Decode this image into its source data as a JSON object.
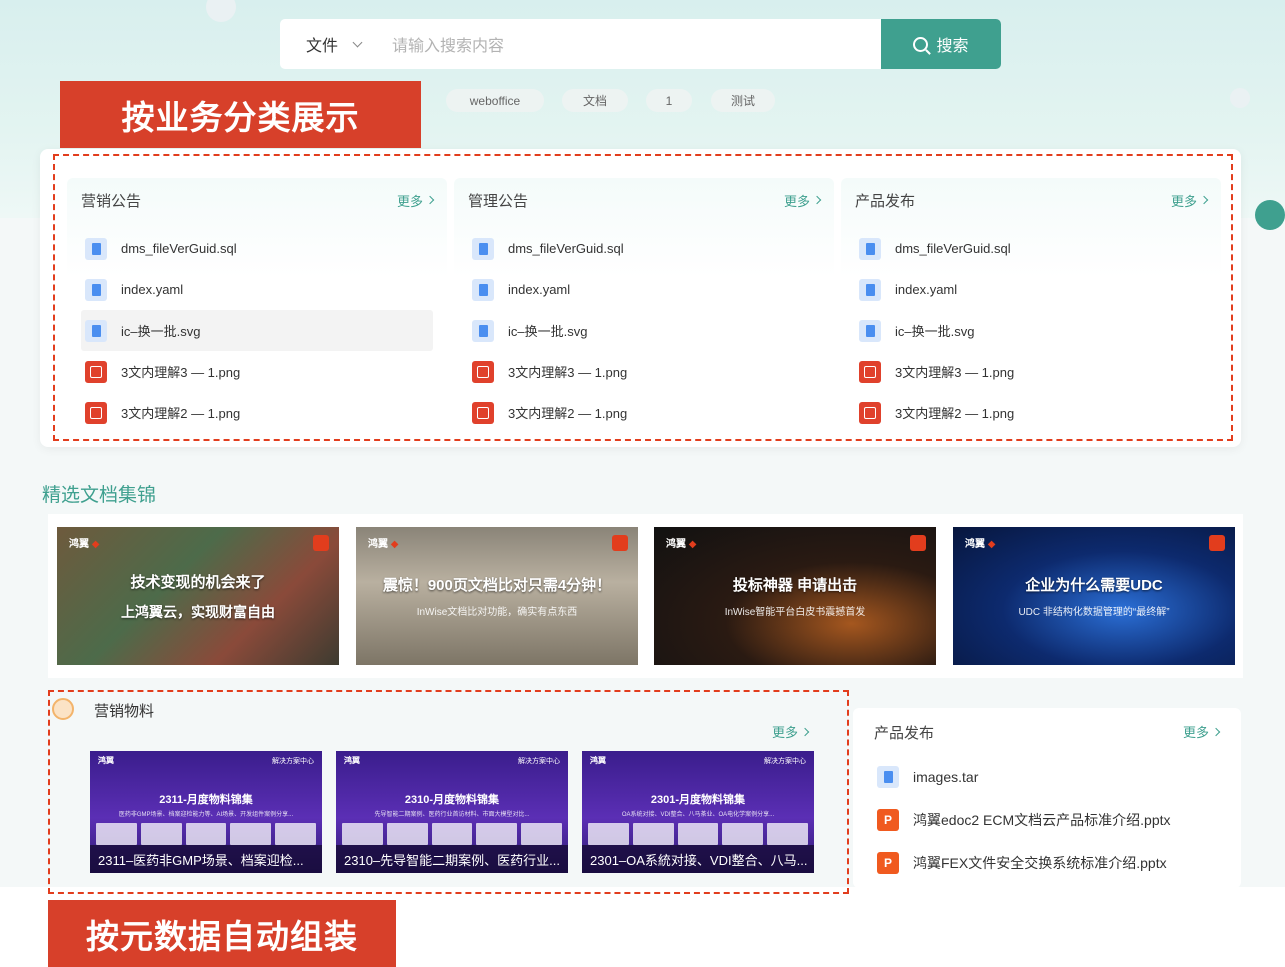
{
  "search": {
    "type_label": "文件",
    "placeholder": "请输入搜索内容",
    "button_label": "搜索",
    "tags": [
      "weboffice",
      "文档",
      "1",
      "测试"
    ]
  },
  "annotations": {
    "top_banner": "按业务分类展示",
    "bottom_banner": "按元数据自动组装"
  },
  "category_cards": [
    {
      "title": "营销公告",
      "more": "更多",
      "files": [
        {
          "name": "dms_fileVerGuid.sql",
          "icon": "doc-icon"
        },
        {
          "name": "index.yaml",
          "icon": "doc-icon"
        },
        {
          "name": "ic–换一批.svg",
          "icon": "doc-icon",
          "highlighted": true
        },
        {
          "name": "3文内理解3 — 1.png",
          "icon": "image-icon"
        },
        {
          "name": "3文内理解2 — 1.png",
          "icon": "image-icon"
        }
      ]
    },
    {
      "title": "管理公告",
      "more": "更多",
      "files": [
        {
          "name": "dms_fileVerGuid.sql",
          "icon": "doc-icon"
        },
        {
          "name": "index.yaml",
          "icon": "doc-icon"
        },
        {
          "name": "ic–换一批.svg",
          "icon": "doc-icon"
        },
        {
          "name": "3文内理解3 — 1.png",
          "icon": "image-icon"
        },
        {
          "name": "3文内理解2 — 1.png",
          "icon": "image-icon"
        }
      ]
    },
    {
      "title": "产品发布",
      "more": "更多",
      "files": [
        {
          "name": "dms_fileVerGuid.sql",
          "icon": "doc-icon"
        },
        {
          "name": "index.yaml",
          "icon": "doc-icon"
        },
        {
          "name": "ic–换一批.svg",
          "icon": "doc-icon"
        },
        {
          "name": "3文内理解3 — 1.png",
          "icon": "image-icon"
        },
        {
          "name": "3文内理解2 — 1.png",
          "icon": "image-icon"
        }
      ]
    }
  ],
  "featured": {
    "title": "精选文档集锦",
    "brand": "鸿翼",
    "items": [
      {
        "line1": "技术变现的机会来了",
        "line2": "上鸿翼云，实现财富自由",
        "sub": ""
      },
      {
        "line1": "震惊！900页文档比对只需4分钟！",
        "line2": "",
        "sub": "InWise文档比对功能，确实有点东西"
      },
      {
        "line1": "投标神器 申请出击",
        "line2": "",
        "sub": "InWise智能平台白皮书震撼首发"
      },
      {
        "line1": "企业为什么需要UDC",
        "line2": "",
        "sub": "UDC 非结构化数据管理的“最终解”"
      }
    ]
  },
  "marketing": {
    "title": "营销物料",
    "more": "更多",
    "header_brand": "鸿翼",
    "header_right": "解决方案中心",
    "items": [
      {
        "heading": "2311-月度物料锦集",
        "sub": "医药非GMP场景、档案迎检能力等、AI场景、开发组件案例分享...",
        "caption": "2311–医药非GMP场景、档案迎检..."
      },
      {
        "heading": "2310-月度物料锦集",
        "sub": "先导智能二期案例、医药行业首访材料、市面大模型对比...",
        "caption": "2310–先导智能二期案例、医药行业..."
      },
      {
        "heading": "2301-月度物料锦集",
        "sub": "OA系统对接、VDI整合、八马茶业、OA电化学案例分享...",
        "caption": "2301–OA系統对接、VDI整合、八马..."
      }
    ]
  },
  "product_release": {
    "title": "产品发布",
    "more": "更多",
    "files": [
      {
        "name": "images.tar",
        "icon": "doc-icon"
      },
      {
        "name": "鸿翼edoc2 ECM文档云产品标准介绍.pptx",
        "icon": "ppt-icon",
        "glyph": "P"
      },
      {
        "name": "鸿翼FEX文件安全交换系统标准介绍.pptx",
        "icon": "ppt-icon",
        "glyph": "P"
      }
    ]
  }
}
